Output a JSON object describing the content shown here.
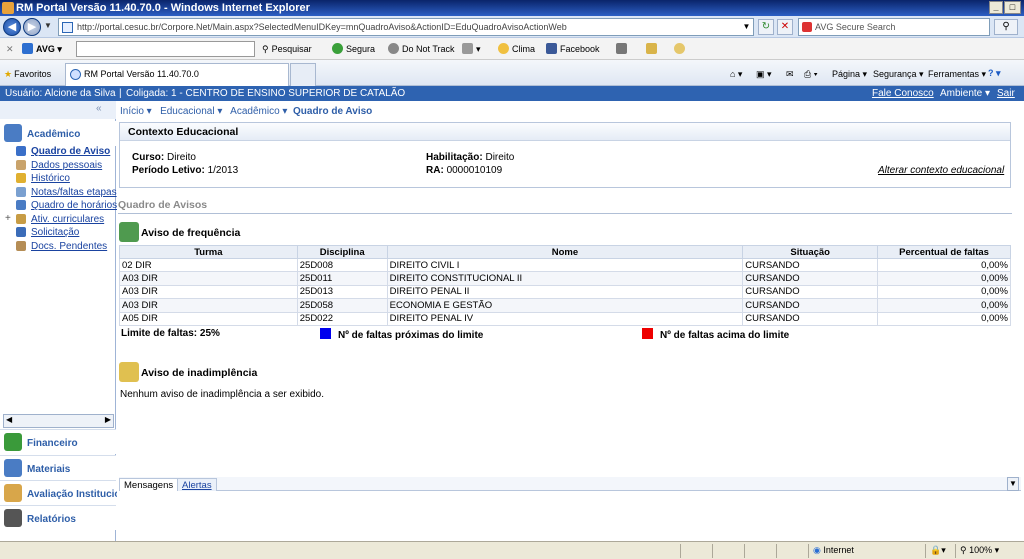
{
  "window": {
    "title": "RM Portal Versão 11.40.70.0 - Windows Internet Explorer"
  },
  "browser": {
    "address": "http://portal.cesuc.br/Corpore.Net/Main.aspx?SelectedMenuIDKey=mnQuadroAviso&ActionID=EduQuadroAvisoActionWeb",
    "search_placeholder": "AVG Secure Search",
    "toolbar": {
      "avg_label": "AVG",
      "pesquisar": "Pesquisar",
      "segura": "Segura",
      "do_not_track": "Do Not Track",
      "clima": "Clima",
      "facebook": "Facebook"
    },
    "favorites_label": "Favoritos",
    "tab_title": "RM Portal Versão 11.40.70.0",
    "command_bar": {
      "pagina": "Página",
      "seguranca": "Segurança",
      "ferramentas": "Ferramentas"
    },
    "status": {
      "zone": "Internet",
      "zoom": "100%"
    }
  },
  "portal": {
    "user": "Usuário: Alcione da Silva",
    "coligada": "Coligada: 1 - CENTRO DE ENSINO SUPERIOR DE CATALÃO",
    "fale_conosco": "Fale Conosco",
    "ambiente": "Ambiente",
    "sair": "Sair"
  },
  "sidebar": {
    "collapse_glyph": "«",
    "section_academico": "Acadêmico",
    "items": [
      {
        "label": "Quadro de Aviso",
        "color": "#3a6fc8"
      },
      {
        "label": "Dados pessoais",
        "color": "#c9a36b"
      },
      {
        "label": "Histórico",
        "color": "#e0b030"
      },
      {
        "label": "Notas/faltas etapas",
        "color": "#7aa0d0"
      },
      {
        "label": "Quadro de horários",
        "color": "#4a7cc4"
      },
      {
        "label": "Ativ. curriculares",
        "color": "#c79c45"
      },
      {
        "label": "Solicitação",
        "color": "#3b6cb8"
      },
      {
        "label": "Docs. Pendentes",
        "color": "#b58d55"
      }
    ],
    "sections": [
      {
        "label": "Financeiro",
        "color": "#3a9a3a"
      },
      {
        "label": "Materiais",
        "color": "#4a7cc4"
      },
      {
        "label": "Avaliação Institucional",
        "color": "#d8a64a"
      },
      {
        "label": "Relatórios",
        "color": "#555"
      }
    ]
  },
  "breadcrumb": {
    "inicio": "Início",
    "educacional": "Educacional",
    "academico": "Acadêmico",
    "current": "Quadro de Aviso"
  },
  "contexto": {
    "title": "Contexto Educacional",
    "curso_label": "Curso:",
    "curso": "Direito",
    "periodo_label": "Período Letivo:",
    "periodo": "1/2013",
    "habilitacao_label": "Habilitação:",
    "habilitacao": "Direito",
    "ra_label": "RA:",
    "ra": "0000010109",
    "alterar": "Alterar contexto educacional"
  },
  "quadro_title": "Quadro de Avisos",
  "frequencia": {
    "title": "Aviso de frequência",
    "columns": [
      "Turma",
      "Disciplina",
      "Nome",
      "Situação",
      "Percentual de faltas"
    ],
    "rows": [
      [
        "02 DIR",
        "25D008",
        "DIREITO CIVIL I",
        "CURSANDO",
        "0,00%"
      ],
      [
        "A03 DIR",
        "25D011",
        "DIREITO CONSTITUCIONAL II",
        "CURSANDO",
        "0,00%"
      ],
      [
        "A03 DIR",
        "25D013",
        "DIREITO PENAL II",
        "CURSANDO",
        "0,00%"
      ],
      [
        "A03 DIR",
        "25D058",
        "ECONOMIA E GESTÃO",
        "CURSANDO",
        "0,00%"
      ],
      [
        "A05 DIR",
        "25D022",
        "DIREITO PENAL IV",
        "CURSANDO",
        "0,00%"
      ]
    ],
    "limite": "Limite de faltas: 25%",
    "legend_proximas": "Nº de faltas próximas do limite",
    "legend_acima": "Nº de faltas acima do limite",
    "color_proximas": "#0000ee",
    "color_acima": "#ee0000"
  },
  "inadimplencia": {
    "title": "Aviso de inadimplência",
    "message": "Nenhum aviso de inadimplência a ser exibido."
  },
  "message_tabs": {
    "mensagens": "Mensagens",
    "alertas": "Alertas"
  }
}
